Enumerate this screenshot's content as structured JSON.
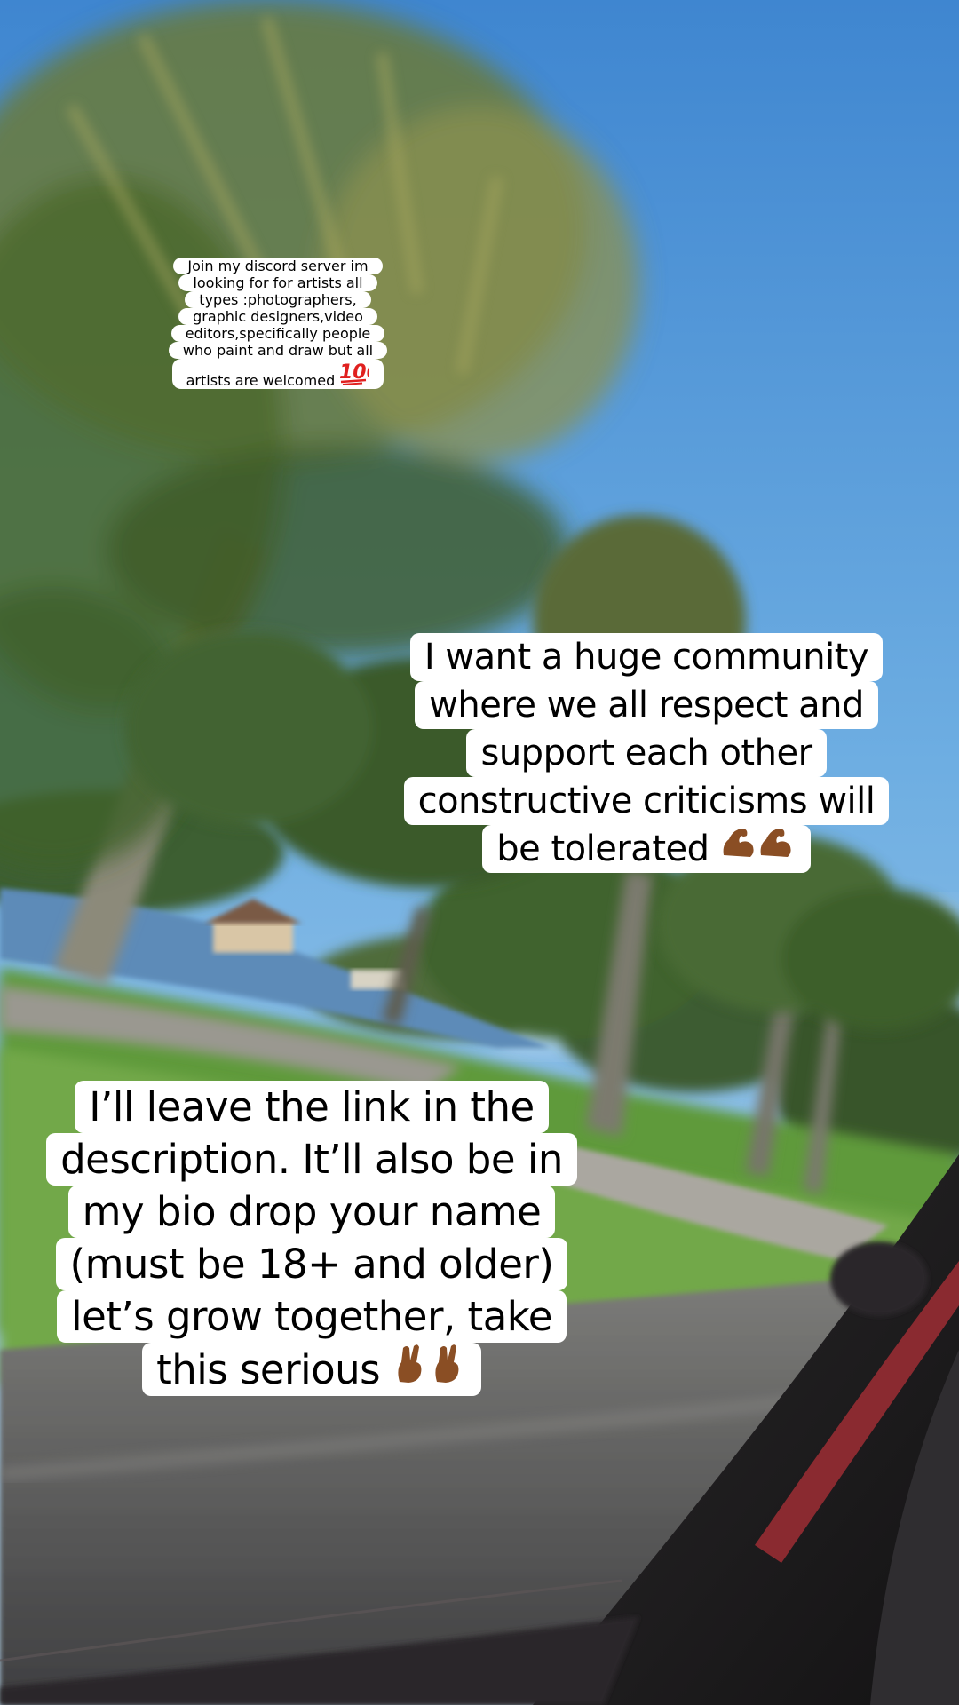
{
  "story": {
    "captions": [
      {
        "lines": [
          "Join my discord server im",
          "looking for for artists all",
          "types :photographers,",
          "graphic designers,video",
          "editors,specifically people",
          "who paint and draw but all",
          "artists are welcomed"
        ],
        "trailing_emoji": "💯"
      },
      {
        "lines": [
          "I want a huge community",
          "where we all respect and",
          "support each other",
          "constructive criticisms will",
          "be tolerated"
        ],
        "trailing_emoji": "💪🏾💪🏾"
      },
      {
        "lines": [
          "I’ll leave the link in the",
          "description. It’ll also be in",
          "my bio drop your name",
          "(must be 18+ and older)",
          "let’s grow together, take",
          "this serious"
        ],
        "trailing_emoji": "🤞🏾🤞🏾"
      }
    ]
  },
  "colors": {
    "caption_bg": "#ffffff",
    "caption_text": "#000000",
    "sky": "#4f97d8",
    "grass": "#5f9a3a",
    "car_interior": "#1f1d1f"
  },
  "icons": [
    "hundred-points-icon",
    "flexed-biceps-icon",
    "crossed-fingers-icon"
  ]
}
